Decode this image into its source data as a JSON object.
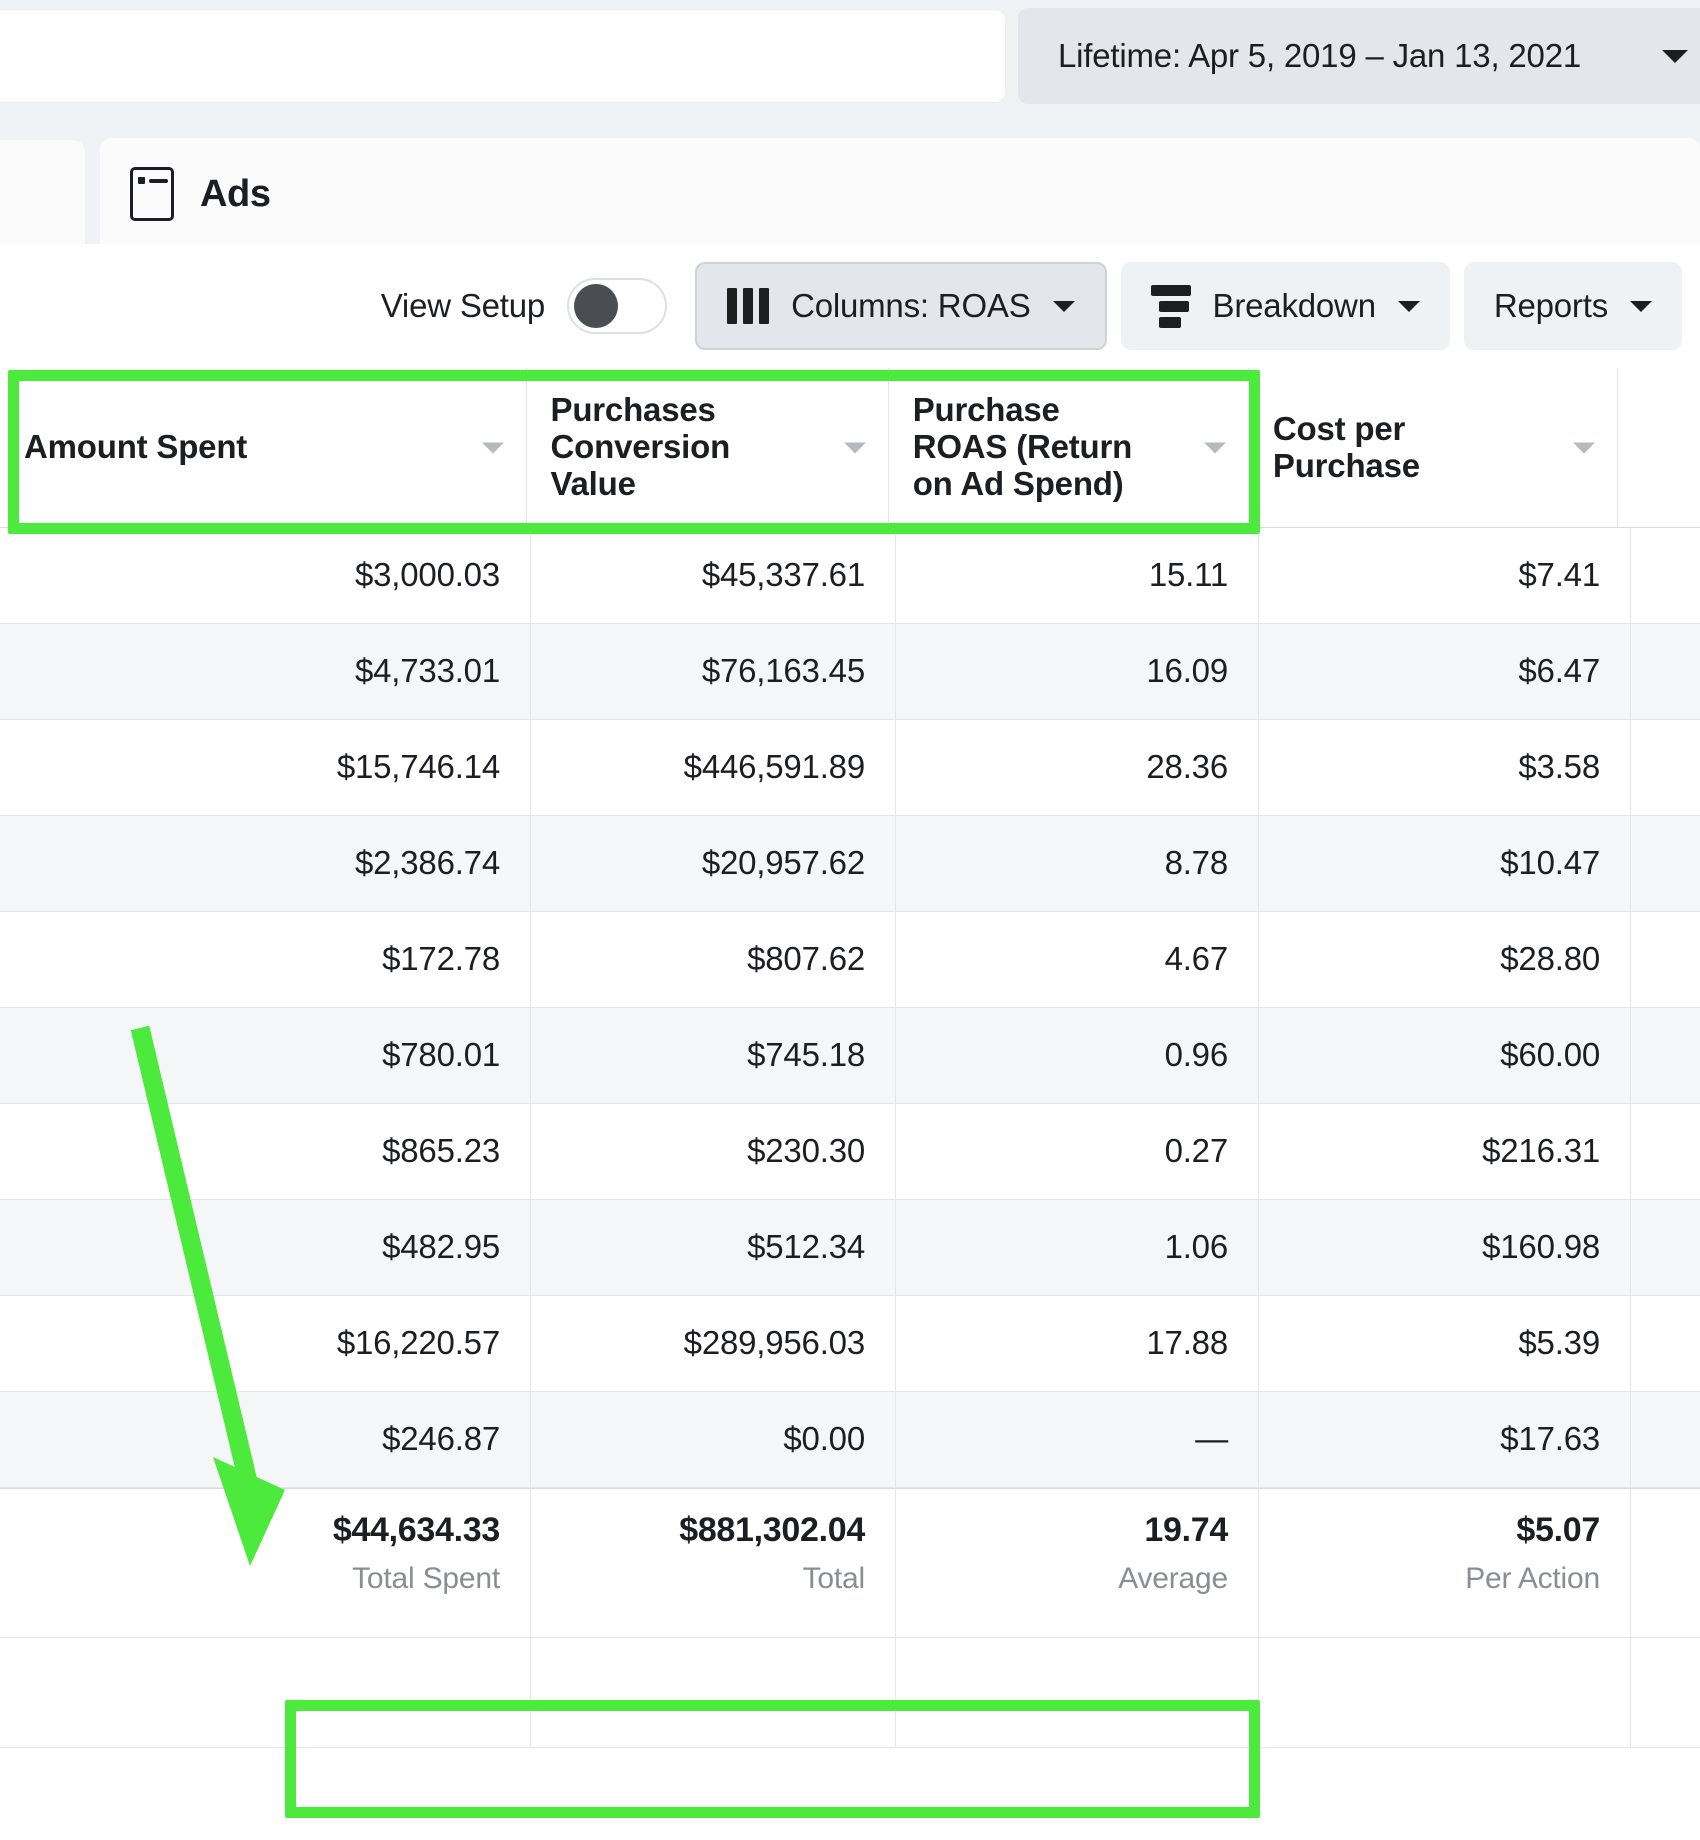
{
  "topbar": {
    "search_placeholder": "",
    "search_value": "",
    "date_range": "Lifetime: Apr 5, 2019 – Jan 13, 2021",
    "date_caret_icon": "chevron-down-icon"
  },
  "tabs": {
    "active_label": "Ads",
    "active_icon": "ad-preview-icon"
  },
  "controls": {
    "view_setup_label": "View Setup",
    "view_setup_toggle": "off",
    "columns_label": "Columns: ROAS",
    "columns_icon": "columns-icon",
    "breakdown_label": "Breakdown",
    "breakdown_icon": "breakdown-icon",
    "reports_label": "Reports",
    "caret_icon": "chevron-down-icon",
    "add_column_icon": "plus-circle-icon"
  },
  "accent_colors": {
    "highlight_green": "#4cea3c",
    "link_blue": "#1877f2",
    "row_alt": "#f5f6f7"
  },
  "table": {
    "headers": [
      "Amount Spent",
      "Purchases\nConversion\nValue",
      "Purchase\nROAS (Return\non Ad Spend)",
      "Cost per\nPurchase"
    ],
    "header_line_groups": [
      [
        "Amount Spent"
      ],
      [
        "Purchases",
        "Conversion",
        "Value"
      ],
      [
        "Purchase",
        "ROAS (Return",
        "on Ad Spend)"
      ],
      [
        "Cost per",
        "Purchase"
      ]
    ],
    "rows": [
      {
        "amount_spent": "$3,000.03",
        "conversion_value": "$45,337.61",
        "roas": "15.11",
        "cost_per_purchase": "$7.41"
      },
      {
        "amount_spent": "$4,733.01",
        "conversion_value": "$76,163.45",
        "roas": "16.09",
        "cost_per_purchase": "$6.47"
      },
      {
        "amount_spent": "$15,746.14",
        "conversion_value": "$446,591.89",
        "roas": "28.36",
        "cost_per_purchase": "$3.58"
      },
      {
        "amount_spent": "$2,386.74",
        "conversion_value": "$20,957.62",
        "roas": "8.78",
        "cost_per_purchase": "$10.47"
      },
      {
        "amount_spent": "$172.78",
        "conversion_value": "$807.62",
        "roas": "4.67",
        "cost_per_purchase": "$28.80"
      },
      {
        "amount_spent": "$780.01",
        "conversion_value": "$745.18",
        "roas": "0.96",
        "cost_per_purchase": "$60.00"
      },
      {
        "amount_spent": "$865.23",
        "conversion_value": "$230.30",
        "roas": "0.27",
        "cost_per_purchase": "$216.31"
      },
      {
        "amount_spent": "$482.95",
        "conversion_value": "$512.34",
        "roas": "1.06",
        "cost_per_purchase": "$160.98"
      },
      {
        "amount_spent": "$16,220.57",
        "conversion_value": "$289,956.03",
        "roas": "17.88",
        "cost_per_purchase": "$5.39"
      },
      {
        "amount_spent": "$246.87",
        "conversion_value": "$0.00",
        "roas": "—",
        "cost_per_purchase": "$17.63"
      }
    ],
    "totals": {
      "amount_spent_value": "$44,634.33",
      "amount_spent_label": "Total Spent",
      "conversion_value_value": "$881,302.04",
      "conversion_value_label": "Total",
      "roas_value": "19.74",
      "roas_label": "Average",
      "cost_per_purchase_value": "$5.07",
      "cost_per_purchase_label": "Per Action"
    }
  },
  "annotations": {
    "header_highlight": "green-rectangle-around-amount-spent-conversion-value-roas-headers",
    "totals_highlight": "green-rectangle-around-totals",
    "arrow": "green-arrow-pointing-down-to-last-row"
  }
}
